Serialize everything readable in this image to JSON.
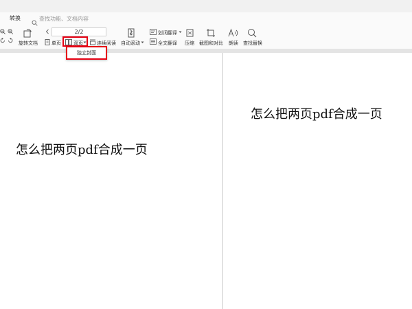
{
  "tabbar": {
    "tab_label": "转换",
    "search_placeholder": "查找功能、文档内容"
  },
  "toolbar": {
    "page_indicator": "2/2",
    "rotate_label": "旋转文档",
    "single_page_label": "单页",
    "double_page_label": "双页",
    "continuous_label": "连续阅读",
    "auto_scroll_label": "自动滚动",
    "word_translate_label": "划词翻译",
    "full_translate_label": "全文翻译",
    "compress_label": "压缩",
    "screenshot_compare_label": "截图和对比",
    "read_aloud_label": "朗读",
    "find_replace_label": "查找替换"
  },
  "dropdown": {
    "item_label": "独立封面"
  },
  "document": {
    "left_page_text": "怎么把两页pdf合成一页",
    "right_page_text": "怎么把两页pdf合成一页"
  },
  "colors": {
    "highlight": "#e60012",
    "toolbar_bg": "#fafafa",
    "page_bg": "#ffffff"
  }
}
